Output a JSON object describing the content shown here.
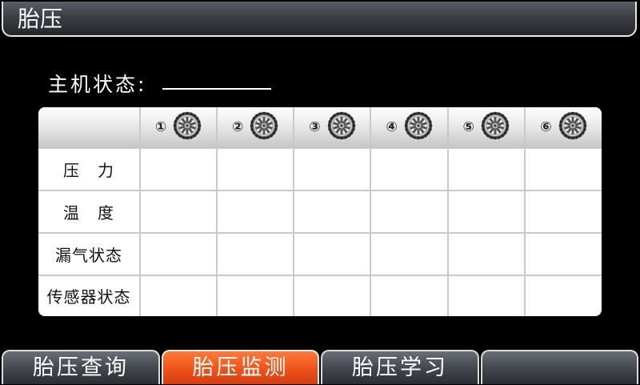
{
  "window": {
    "title": "胎压"
  },
  "host_status": {
    "label": "主机状态:",
    "value": ""
  },
  "table": {
    "tires": [
      {
        "num": "①",
        "icon": "tire-icon"
      },
      {
        "num": "②",
        "icon": "tire-icon"
      },
      {
        "num": "③",
        "icon": "tire-icon"
      },
      {
        "num": "④",
        "icon": "tire-icon"
      },
      {
        "num": "⑤",
        "icon": "tire-icon"
      },
      {
        "num": "⑥",
        "icon": "tire-icon"
      }
    ],
    "rows": [
      {
        "label": "压   力",
        "values": [
          "",
          "",
          "",
          "",
          "",
          ""
        ]
      },
      {
        "label": "温   度",
        "values": [
          "",
          "",
          "",
          "",
          "",
          ""
        ]
      },
      {
        "label": "漏气状态",
        "values": [
          "",
          "",
          "",
          "",
          "",
          ""
        ]
      },
      {
        "label": "传感器状态",
        "values": [
          "",
          "",
          "",
          "",
          "",
          ""
        ]
      }
    ]
  },
  "tabs": [
    {
      "label": "胎压查询",
      "active": false
    },
    {
      "label": "胎压监测",
      "active": true
    },
    {
      "label": "胎压学习",
      "active": false
    },
    {
      "label": "",
      "active": false
    }
  ],
  "colors": {
    "active_tab": "#f0561c",
    "background": "#000000"
  }
}
